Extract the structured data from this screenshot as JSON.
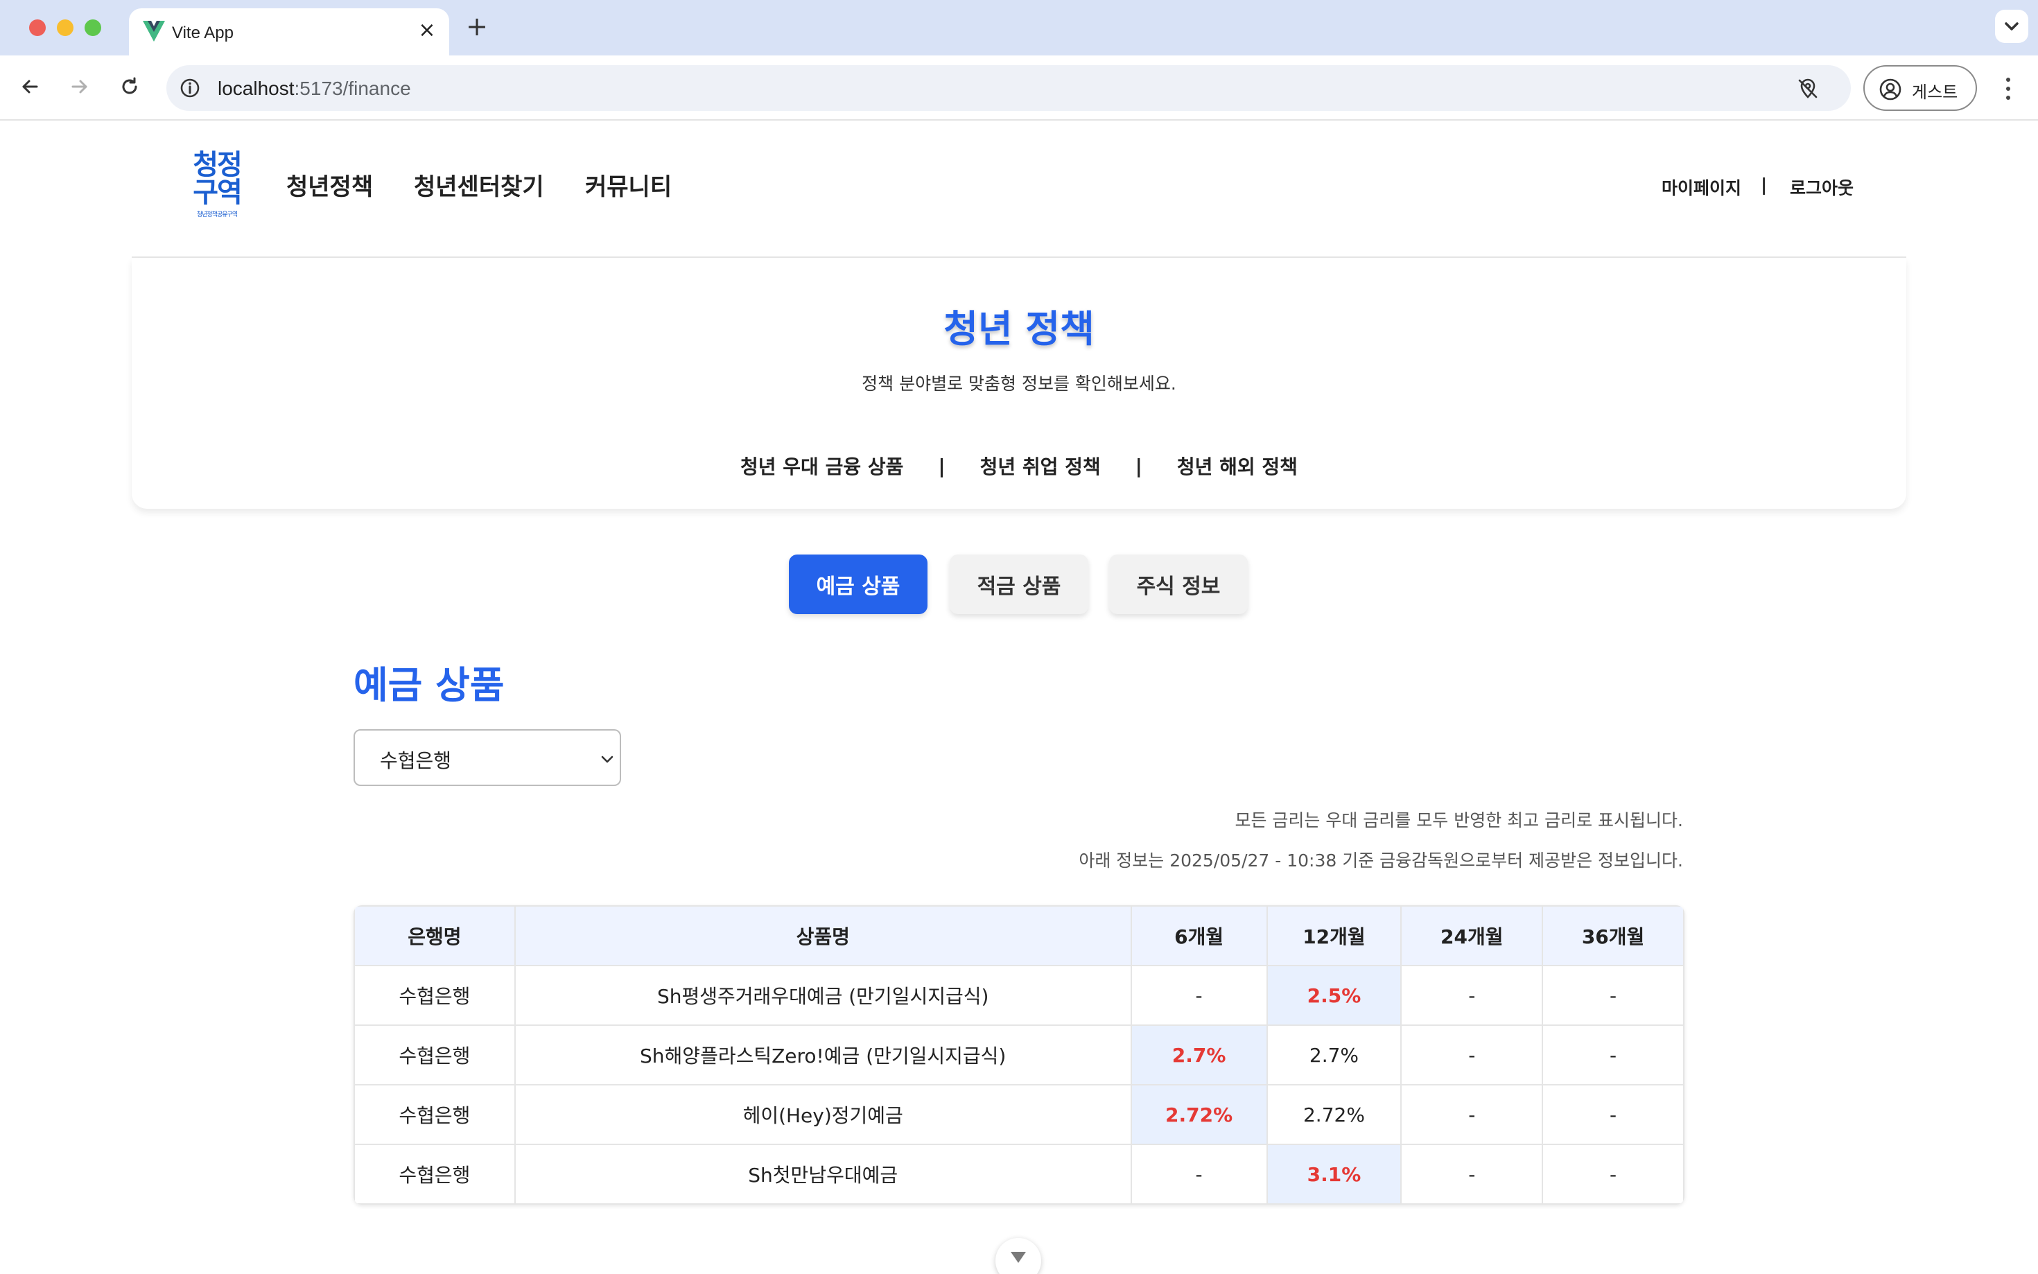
{
  "browser": {
    "tab_title": "Vite App",
    "url_host": "localhost",
    "url_rest": ":5173/finance",
    "profile_label": "게스트"
  },
  "site": {
    "logo_line1": "청정",
    "logo_line2": "구역",
    "logo_tagline": "청년정책공유구역",
    "nav": [
      "청년정책",
      "청년센터찾기",
      "커뮤니티"
    ],
    "user_nav": {
      "mypage": "마이페이지",
      "separator": "|",
      "logout": "로그아웃"
    }
  },
  "policy": {
    "title": "청년 정책",
    "subtitle": "정책 분야별로 맞춤형 정보를 확인해보세요.",
    "links": [
      "청년 우대 금융 상품",
      "청년 취업 정책",
      "청년 해외 정책"
    ],
    "separator": "|"
  },
  "tabs": [
    {
      "label": "예금 상품",
      "active": true
    },
    {
      "label": "적금 상품",
      "active": false
    },
    {
      "label": "주식 정보",
      "active": false
    }
  ],
  "section": {
    "title": "예금 상품",
    "selected_bank": "수협은행",
    "note_1": "모든 금리는 우대 금리를 모두 반영한 최고 금리로 표시됩니다.",
    "note_2": "아래 정보는 2025/05/27 - 10:38 기준 금융감독원으로부터 제공받은 정보입니다."
  },
  "table": {
    "headers": [
      "은행명",
      "상품명",
      "6개월",
      "12개월",
      "24개월",
      "36개월"
    ],
    "rows": [
      {
        "bank": "수협은행",
        "product": "Sh평생주거래우대예금 (만기일시지급식)",
        "m6": "-",
        "m12": "2.5%",
        "m24": "-",
        "m36": "-",
        "best": "m12"
      },
      {
        "bank": "수협은행",
        "product": "Sh해양플라스틱Zero!예금 (만기일시지급식)",
        "m6": "2.7%",
        "m12": "2.7%",
        "m24": "-",
        "m36": "-",
        "best": "m6"
      },
      {
        "bank": "수협은행",
        "product": "헤이(Hey)정기예금",
        "m6": "2.72%",
        "m12": "2.72%",
        "m24": "-",
        "m36": "-",
        "best": "m6"
      },
      {
        "bank": "수협은행",
        "product": "Sh첫만남우대예금",
        "m6": "-",
        "m12": "3.1%",
        "m24": "-",
        "m36": "-",
        "best": "m12"
      }
    ]
  },
  "colors": {
    "accent": "#2563eb",
    "highlight_bg": "#e8f0fe",
    "highlight_text": "#e53935"
  }
}
